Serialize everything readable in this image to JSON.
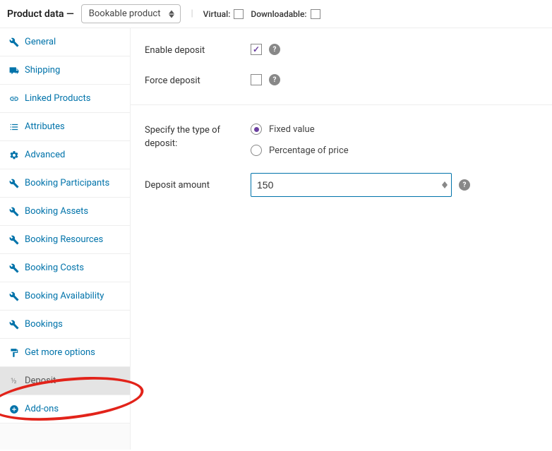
{
  "header": {
    "title": "Product data —",
    "product_type": "Bookable product",
    "virtual_label": "Virtual:",
    "downloadable_label": "Downloadable:"
  },
  "sidebar": {
    "items": [
      {
        "icon": "wrench",
        "label": "General"
      },
      {
        "icon": "truck",
        "label": "Shipping"
      },
      {
        "icon": "link",
        "label": "Linked Products"
      },
      {
        "icon": "list",
        "label": "Attributes"
      },
      {
        "icon": "gear",
        "label": "Advanced"
      },
      {
        "icon": "wrench",
        "label": "Booking Participants"
      },
      {
        "icon": "wrench",
        "label": "Booking Assets"
      },
      {
        "icon": "wrench",
        "label": "Booking Resources"
      },
      {
        "icon": "wrench",
        "label": "Booking Costs"
      },
      {
        "icon": "wrench",
        "label": "Booking Availability"
      },
      {
        "icon": "wrench",
        "label": "Bookings"
      },
      {
        "icon": "paint",
        "label": "Get more options"
      },
      {
        "icon": "half",
        "label": "Deposit",
        "active": true
      },
      {
        "icon": "plus-circle",
        "label": "Add-ons"
      }
    ]
  },
  "content": {
    "enable_deposit_label": "Enable deposit",
    "enable_deposit_checked": true,
    "force_deposit_label": "Force deposit",
    "force_deposit_checked": false,
    "deposit_type_label": "Specify the type of deposit:",
    "deposit_type_options": {
      "fixed": "Fixed value",
      "percentage": "Percentage of price"
    },
    "deposit_type_selected": "fixed",
    "deposit_amount_label": "Deposit amount",
    "deposit_amount_value": "150"
  }
}
